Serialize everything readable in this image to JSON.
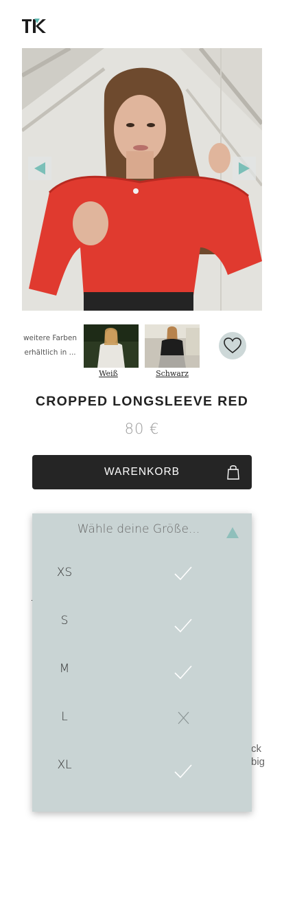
{
  "brand": {
    "logo_text": "TK",
    "accent": "#5fb8b0"
  },
  "product": {
    "title": "CROPPED LONGSLEEVE RED",
    "price": "80 €",
    "image_icon": "product-photo"
  },
  "gallery": {
    "prev_icon": "arrow-left-icon",
    "next_icon": "arrow-right-icon"
  },
  "colors": {
    "label": "weitere Farben erhältlich in ...",
    "variants": [
      {
        "name": "Weiß"
      },
      {
        "name": "Schwarz"
      }
    ]
  },
  "wishlist": {
    "icon": "heart-icon"
  },
  "cart": {
    "label": "WARENKORB",
    "icon": "shopping-bag-icon"
  },
  "size_selector": {
    "placeholder": "Wähle deine Größe...",
    "sizes": [
      {
        "name": "XS",
        "available": true
      },
      {
        "name": "S",
        "available": true
      },
      {
        "name": "M",
        "available": true
      },
      {
        "name": "L",
        "available": false
      },
      {
        "name": "XL",
        "available": true
      }
    ]
  },
  "background_text": {
    "line1": "ck",
    "line2": "big"
  },
  "colors_palette": {
    "button": "#252525",
    "panel": "#c9d4d4",
    "wish_bg": "#cdd8d8"
  }
}
